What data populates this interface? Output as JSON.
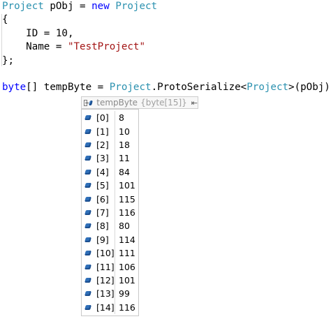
{
  "code": {
    "lines": [
      [
        {
          "t": "Project",
          "c": "type"
        },
        {
          "t": " pObj = ",
          "c": "plain"
        },
        {
          "t": "new",
          "c": "kw"
        },
        {
          "t": " ",
          "c": "plain"
        },
        {
          "t": "Project",
          "c": "type"
        }
      ],
      [
        {
          "t": "{",
          "c": "plain"
        }
      ],
      [
        {
          "t": "    ID = 10,",
          "c": "plain"
        }
      ],
      [
        {
          "t": "    Name = ",
          "c": "plain"
        },
        {
          "t": "\"TestProject\"",
          "c": "str"
        }
      ],
      [
        {
          "t": "};",
          "c": "plain"
        }
      ],
      [
        {
          "t": "",
          "c": "plain"
        }
      ],
      [
        {
          "t": "byte",
          "c": "kw"
        },
        {
          "t": "[] tempByte = ",
          "c": "plain"
        },
        {
          "t": "Project",
          "c": "type"
        },
        {
          "t": ".ProtoSerialize<",
          "c": "plain"
        },
        {
          "t": "Project",
          "c": "type"
        },
        {
          "t": ">(pObj);",
          "c": "plain"
        }
      ]
    ]
  },
  "datatip": {
    "name": "tempByte",
    "type": "{byte[15]}",
    "pin_icon": "pin-icon",
    "items": [
      {
        "index": "[0]",
        "value": "8"
      },
      {
        "index": "[1]",
        "value": "10"
      },
      {
        "index": "[2]",
        "value": "18"
      },
      {
        "index": "[3]",
        "value": "11"
      },
      {
        "index": "[4]",
        "value": "84"
      },
      {
        "index": "[5]",
        "value": "101"
      },
      {
        "index": "[6]",
        "value": "115"
      },
      {
        "index": "[7]",
        "value": "116"
      },
      {
        "index": "[8]",
        "value": "80"
      },
      {
        "index": "[9]",
        "value": "114"
      },
      {
        "index": "[10]",
        "value": "111"
      },
      {
        "index": "[11]",
        "value": "106"
      },
      {
        "index": "[12]",
        "value": "101"
      },
      {
        "index": "[13]",
        "value": "99"
      },
      {
        "index": "[14]",
        "value": "116"
      }
    ]
  },
  "colors": {
    "type": "#2b91af",
    "keyword": "#0000ff",
    "string": "#a31515"
  }
}
